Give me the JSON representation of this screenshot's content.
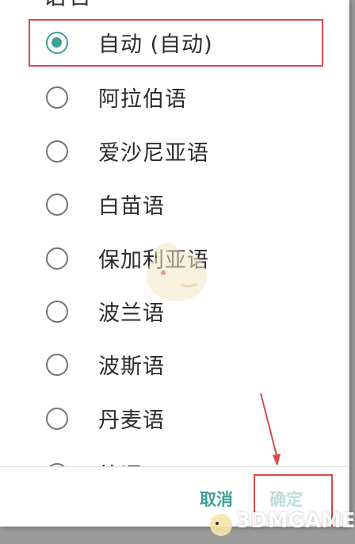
{
  "dialog": {
    "title": "语言",
    "options": [
      {
        "label": "自动 (自动)",
        "selected": true
      },
      {
        "label": "阿拉伯语",
        "selected": false
      },
      {
        "label": "爱沙尼亚语",
        "selected": false
      },
      {
        "label": "白苗语",
        "selected": false
      },
      {
        "label": "保加利亚语",
        "selected": false
      },
      {
        "label": "波兰语",
        "selected": false
      },
      {
        "label": "波斯语",
        "selected": false
      },
      {
        "label": "丹麦语",
        "selected": false
      },
      {
        "label": "德语",
        "selected": false
      }
    ],
    "cancel_label": "取消",
    "ok_label": "确定"
  },
  "colors": {
    "accent": "#3f9f94",
    "highlight": "#d84a4a"
  },
  "watermark": "3DMGAME"
}
